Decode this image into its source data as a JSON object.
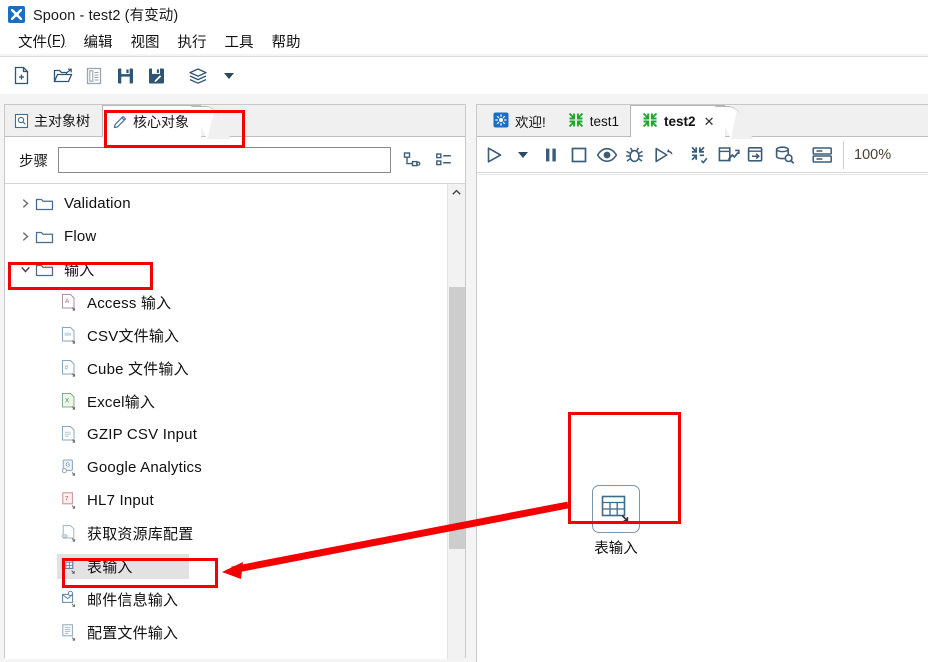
{
  "window": {
    "title": "Spoon - test2 (有变动)",
    "icon": "spoon-app-icon"
  },
  "menubar": {
    "items": [
      {
        "label": "文件",
        "mnemonic": "(F)"
      },
      {
        "label": "编辑",
        "mnemonic": ""
      },
      {
        "label": "视图",
        "mnemonic": ""
      },
      {
        "label": "执行",
        "mnemonic": ""
      },
      {
        "label": "工具",
        "mnemonic": ""
      },
      {
        "label": "帮助",
        "mnemonic": ""
      }
    ]
  },
  "toolbar": {
    "buttons": [
      {
        "name": "new-file-icon",
        "title": "新建"
      },
      {
        "name": "open-folder-icon",
        "title": "打开"
      },
      {
        "name": "explorer-icon",
        "title": "资源库浏览"
      },
      {
        "name": "save-icon",
        "title": "保存"
      },
      {
        "name": "save-as-icon",
        "title": "另存为"
      },
      {
        "name": "layers-icon",
        "title": "资源库"
      },
      {
        "name": "chevron-down-icon",
        "title": "更多"
      }
    ]
  },
  "left_panel": {
    "tabs": [
      {
        "label": "主对象树",
        "icon": "document-search-icon",
        "active": false
      },
      {
        "label": "核心对象",
        "icon": "pencil-icon",
        "active": true
      }
    ],
    "search": {
      "label": "步骤",
      "value": "",
      "placeholder": ""
    },
    "search_tools": [
      {
        "name": "expand-tree-icon"
      },
      {
        "name": "collapse-list-icon"
      }
    ],
    "tree": [
      {
        "label": "Validation",
        "type": "folder",
        "expanded": false,
        "icon": "folder-icon"
      },
      {
        "label": "Flow",
        "type": "folder",
        "expanded": false,
        "icon": "folder-icon"
      },
      {
        "label": "输入",
        "type": "folder",
        "expanded": true,
        "icon": "folder-icon",
        "highlighted": true
      },
      {
        "label": "Access 输入",
        "type": "step",
        "icon": "access-input-icon"
      },
      {
        "label": "CSV文件输入",
        "type": "step",
        "icon": "csv-input-icon"
      },
      {
        "label": "Cube 文件输入",
        "type": "step",
        "icon": "cube-input-icon"
      },
      {
        "label": "Excel输入",
        "type": "step",
        "icon": "excel-input-icon"
      },
      {
        "label": "GZIP CSV Input",
        "type": "step",
        "icon": "gzip-csv-input-icon"
      },
      {
        "label": "Google Analytics",
        "type": "step",
        "icon": "google-analytics-icon"
      },
      {
        "label": "HL7 Input",
        "type": "step",
        "icon": "hl7-input-icon"
      },
      {
        "label": "获取资源库配置",
        "type": "step",
        "icon": "repository-config-icon"
      },
      {
        "label": "表输入",
        "type": "step",
        "icon": "table-input-icon",
        "selected": true,
        "highlighted": true
      },
      {
        "label": "邮件信息输入",
        "type": "step",
        "icon": "mail-input-icon"
      },
      {
        "label": "配置文件输入",
        "type": "step",
        "icon": "properties-input-icon"
      }
    ],
    "scrollbar": {
      "name": "vertical-scrollbar"
    }
  },
  "right_panel": {
    "tabs": [
      {
        "label": "欢迎!",
        "icon": "spoon-welcome-icon",
        "active": false,
        "closable": false
      },
      {
        "label": "test1",
        "icon": "transformation-icon",
        "active": false,
        "closable": false
      },
      {
        "label": "test2",
        "icon": "transformation-icon",
        "active": true,
        "closable": true,
        "close_glyph": "✕"
      }
    ],
    "toolbar": {
      "buttons": [
        {
          "name": "run-icon",
          "title": "运行"
        },
        {
          "name": "run-options-chevron-icon",
          "title": "运行选项"
        },
        {
          "name": "pause-icon",
          "title": "暂停"
        },
        {
          "name": "stop-icon",
          "title": "停止"
        },
        {
          "name": "preview-icon",
          "title": "预览"
        },
        {
          "name": "debug-icon",
          "title": "调试"
        },
        {
          "name": "replay-icon",
          "title": "重放"
        },
        {
          "name": "verify-transformation-icon",
          "title": "检验这个转换"
        },
        {
          "name": "impact-analysis-icon",
          "title": "影响分析"
        },
        {
          "name": "generate-sql-icon",
          "title": "生成SQL"
        },
        {
          "name": "database-explore-icon",
          "title": "数据库浏览"
        },
        {
          "name": "show-grid-icon",
          "title": "显示网格"
        }
      ],
      "zoom": "100%"
    },
    "canvas": {
      "nodes": [
        {
          "label": "表输入",
          "icon": "table-input-icon",
          "highlighted": true
        }
      ]
    }
  },
  "annotations": {
    "color": "#f40000",
    "boxes": [
      {
        "name": "annotation-box-core-objects-tab",
        "target": "核心对象"
      },
      {
        "name": "annotation-box-input-folder",
        "target": "输入"
      },
      {
        "name": "annotation-box-table-input-step",
        "target": "表输入"
      },
      {
        "name": "annotation-box-canvas-node",
        "target": "表输入"
      }
    ],
    "arrow": {
      "name": "annotation-arrow",
      "from": "canvas-node",
      "to": "tree-item-table-input"
    }
  }
}
